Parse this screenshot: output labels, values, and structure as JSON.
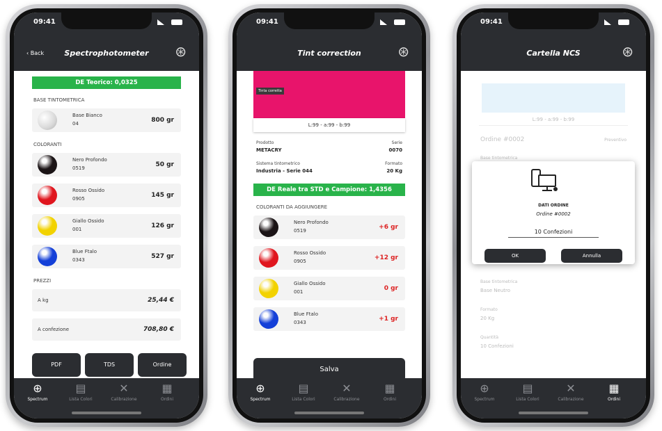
{
  "status_time": "09:41",
  "phone1": {
    "back_label": "Back",
    "title": "Spectrophotometer",
    "de_label": "DE Teorico: 0,0325",
    "base_section": "BASE TINTOMETRICA",
    "base": {
      "name": "Base Bianco",
      "code": "04",
      "qty": "800 gr"
    },
    "colorants_section": "COLORANTI",
    "colorants": [
      {
        "name": "Nero Profondo",
        "code": "0519",
        "qty": "50 gr",
        "color": "#1b1416"
      },
      {
        "name": "Rosso Ossido",
        "code": "0905",
        "qty": "145 gr",
        "color": "#e0161e"
      },
      {
        "name": "Giallo Ossido",
        "code": "001",
        "qty": "126 gr",
        "color": "#f2d200"
      },
      {
        "name": "Blue Ftalo",
        "code": "0343",
        "qty": "527 gr",
        "color": "#1440d8"
      }
    ],
    "prices_section": "PREZZI",
    "prices": [
      {
        "label": "A kg",
        "value": "25,44 €"
      },
      {
        "label": "A confezione",
        "value": "708,80 €"
      }
    ],
    "buttons": [
      "PDF",
      "TDS",
      "Ordine"
    ]
  },
  "phone2": {
    "title": "Tint correction",
    "sample_label": "Tinta corretta",
    "lab_values": "L:99 - a:99 - b:99",
    "prodotto_label": "Prodotto",
    "prodotto_value": "METACRY",
    "serie_label": "Serie",
    "serie_value": "0070",
    "sistema_label": "Sistema tintometrico",
    "sistema_value": "Industria - Serie 044",
    "formato_label": "Formato",
    "formato_value": "20 Kg",
    "de_label": "DE Reale tra STD e Campione: 1,4356",
    "section": "COLORANTI DA AGGIUNGERE",
    "colorants": [
      {
        "name": "Nero Profondo",
        "code": "0519",
        "qty": "+6 gr",
        "color": "#1b1416"
      },
      {
        "name": "Rosso Ossido",
        "code": "0905",
        "qty": "+12 gr",
        "color": "#e0161e"
      },
      {
        "name": "Giallo Ossido",
        "code": "001",
        "qty": "0 gr",
        "color": "#f2d200"
      },
      {
        "name": "Blue Ftalo",
        "code": "0343",
        "qty": "+1 gr",
        "color": "#1440d8"
      }
    ],
    "save_label": "Salva"
  },
  "phone3": {
    "title": "Cartella NCS",
    "lab_values": "L:99 - a:99 - b:99",
    "order_label": "Ordine #0002",
    "order_status": "Preventivo",
    "base_label": "Base tintometrica",
    "base_value": "Base Neutro",
    "formato_label": "Formato",
    "formato_value": "20 Kg",
    "quantita_label": "Quantità",
    "quantita_value": "10 Confezioni",
    "modal": {
      "title": "DATI ORDINE",
      "subtitle": "Ordine #0002",
      "input_value": "10 Confezioni",
      "ok": "OK",
      "cancel": "Annulla"
    }
  },
  "tabs": [
    "Spectrum",
    "Lista Colori",
    "Calibrazione",
    "Ordini"
  ]
}
